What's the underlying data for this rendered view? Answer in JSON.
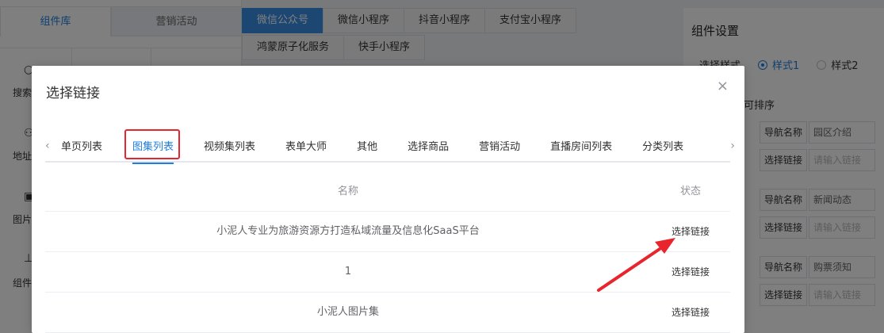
{
  "library": {
    "tabs": [
      "组件库",
      "营销活动"
    ],
    "side_items": [
      {
        "icon": "search-icon",
        "label": "搜索"
      },
      {
        "icon": "user-icon",
        "label": "地址"
      },
      {
        "icon": "image-icon",
        "label": "图片"
      },
      {
        "icon": "component-icon",
        "label": "组件"
      }
    ]
  },
  "channels": {
    "row1": [
      "微信公众号",
      "微信小程序",
      "抖音小程序",
      "支付宝小程序"
    ],
    "row2": [
      "鸿蒙原子化服务",
      "快手小程序"
    ],
    "active": "微信公众号"
  },
  "settings": {
    "title": "组件设置",
    "style_label": "选择样式",
    "style_options": [
      "样式1",
      "样式2"
    ],
    "sort_label": "可排序",
    "rows": [
      {
        "nav_label": "导航名称",
        "nav_value": "园区介绍",
        "link_label": "选择链接",
        "link_placeholder": "请输入链接"
      },
      {
        "nav_label": "导航名称",
        "nav_value": "新闻动态",
        "link_label": "选择链接",
        "link_placeholder": "请输入链接"
      },
      {
        "nav_label": "导航名称",
        "nav_value": "购票须知",
        "link_label": "选择链接",
        "link_placeholder": "请输入链接"
      }
    ]
  },
  "modal": {
    "title": "选择链接",
    "close": "×",
    "tabs": [
      "单页列表",
      "图集列表",
      "视频集列表",
      "表单大师",
      "其他",
      "选择商品",
      "营销活动",
      "直播房间列表",
      "分类列表"
    ],
    "active_tab": "图集列表",
    "table": {
      "headers": [
        "名称",
        "状态"
      ],
      "rows": [
        {
          "name": "小泥人专业为旅游资源方打造私域流量及信息化SaaS平台",
          "action": "选择链接"
        },
        {
          "name": "1",
          "action": "选择链接"
        },
        {
          "name": "小泥人图片集",
          "action": "选择链接"
        }
      ]
    }
  },
  "colors": {
    "accent": "#1f7ee0",
    "annotation": "#e8242c"
  }
}
